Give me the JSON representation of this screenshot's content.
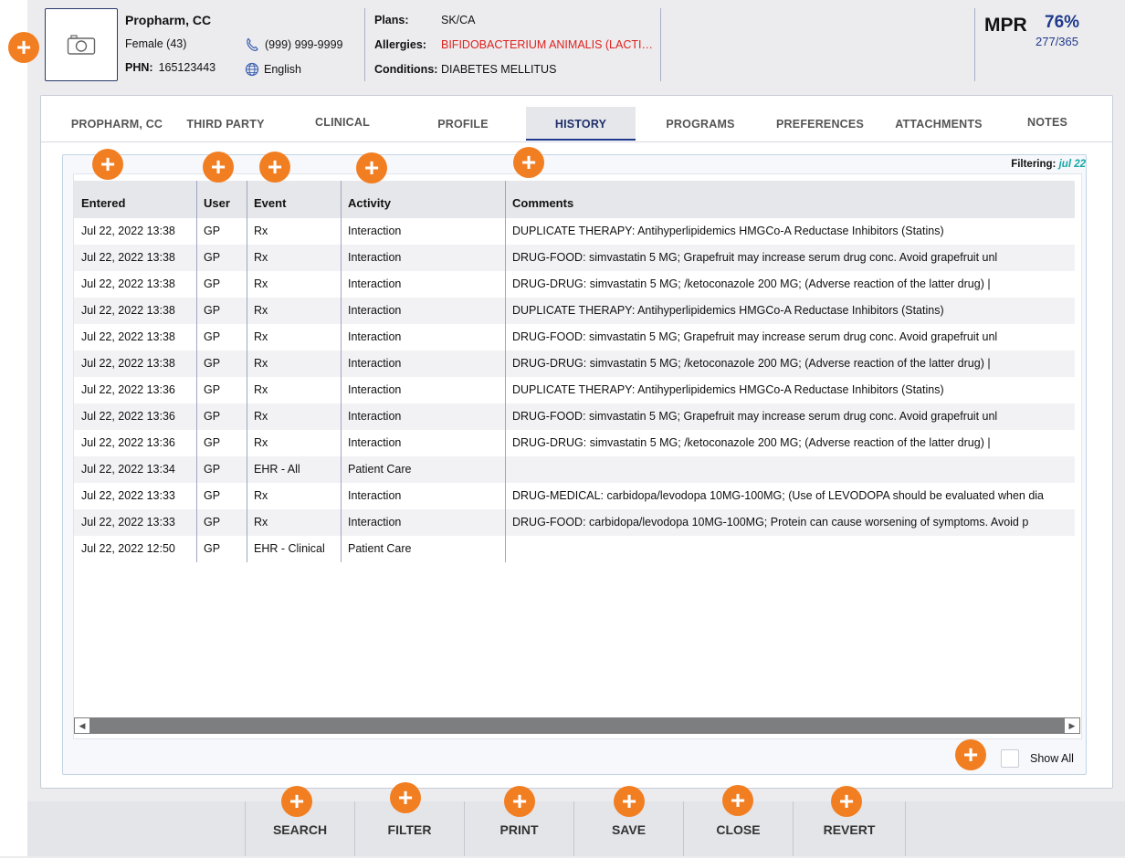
{
  "patient": {
    "name": "Propharm, CC",
    "sex_age": "Female (43)",
    "phn_label": "PHN:",
    "phn": "165123443",
    "phone": "(999) 999-9999",
    "language": "English"
  },
  "info": {
    "plans_label": "Plans:",
    "plans": "SK/CA",
    "allergies_label": "Allergies:",
    "allergies": "BIFIDOBACTERIUM ANIMALIS (LACTIS) BI...",
    "conditions_label": "Conditions:",
    "conditions": "DIABETES MELLITUS"
  },
  "mpr": {
    "label": "MPR",
    "percent": "76%",
    "ratio": "277/365"
  },
  "tabs": [
    {
      "label": "PROPHARM, CC",
      "active": false
    },
    {
      "label": "THIRD PARTY",
      "active": false
    },
    {
      "label": "CLINICAL",
      "active": false
    },
    {
      "label": "PROFILE",
      "active": false
    },
    {
      "label": "HISTORY",
      "active": true
    },
    {
      "label": "PROGRAMS",
      "active": false
    },
    {
      "label": "PREFERENCES",
      "active": false
    },
    {
      "label": "ATTACHMENTS",
      "active": false
    },
    {
      "label": "NOTES",
      "active": false
    }
  ],
  "filter": {
    "label": "Filtering:",
    "value": "jul 22"
  },
  "columns": [
    "Entered",
    "User",
    "Event",
    "Activity",
    "Comments"
  ],
  "rows": [
    [
      "Jul 22, 2022 13:38",
      "GP",
      "Rx",
      "Interaction",
      "DUPLICATE THERAPY: Antihyperlipidemics HMGCo-A Reductase Inhibitors (Statins)"
    ],
    [
      "Jul 22, 2022 13:38",
      "GP",
      "Rx",
      "Interaction",
      "DRUG-FOOD: simvastatin 5 MG; Grapefruit may increase serum drug conc. Avoid grapefruit unl"
    ],
    [
      "Jul 22, 2022 13:38",
      "GP",
      "Rx",
      "Interaction",
      "DRUG-DRUG: simvastatin 5 MG; /ketoconazole 200 MG; (Adverse reaction of the latter drug) |"
    ],
    [
      "Jul 22, 2022 13:38",
      "GP",
      "Rx",
      "Interaction",
      "DUPLICATE THERAPY: Antihyperlipidemics HMGCo-A Reductase Inhibitors (Statins)"
    ],
    [
      "Jul 22, 2022 13:38",
      "GP",
      "Rx",
      "Interaction",
      "DRUG-FOOD: simvastatin 5 MG; Grapefruit may increase serum drug conc. Avoid grapefruit unl"
    ],
    [
      "Jul 22, 2022 13:38",
      "GP",
      "Rx",
      "Interaction",
      "DRUG-DRUG: simvastatin 5 MG; /ketoconazole 200 MG; (Adverse reaction of the latter drug) |"
    ],
    [
      "Jul 22, 2022 13:36",
      "GP",
      "Rx",
      "Interaction",
      "DUPLICATE THERAPY: Antihyperlipidemics HMGCo-A Reductase Inhibitors (Statins)"
    ],
    [
      "Jul 22, 2022 13:36",
      "GP",
      "Rx",
      "Interaction",
      "DRUG-FOOD: simvastatin 5 MG; Grapefruit may increase serum drug conc. Avoid grapefruit unl"
    ],
    [
      "Jul 22, 2022 13:36",
      "GP",
      "Rx",
      "Interaction",
      "DRUG-DRUG: simvastatin 5 MG; /ketoconazole 200 MG; (Adverse reaction of the latter drug) |"
    ],
    [
      "Jul 22, 2022 13:34",
      "GP",
      "EHR - All",
      "Patient Care",
      ""
    ],
    [
      "Jul 22, 2022 13:33",
      "GP",
      "Rx",
      "Interaction",
      "DRUG-MEDICAL: carbidopa/levodopa 10MG-100MG; (Use of LEVODOPA should be evaluated when dia"
    ],
    [
      "Jul 22, 2022 13:33",
      "GP",
      "Rx",
      "Interaction",
      "DRUG-FOOD: carbidopa/levodopa 10MG-100MG; Protein can cause worsening of symptoms. Avoid p"
    ],
    [
      "Jul 22, 2022 12:50",
      "GP",
      "EHR - Clinical",
      "Patient Care",
      ""
    ]
  ],
  "show_all": "Show All",
  "buttons": [
    "SEARCH",
    "FILTER",
    "PRINT",
    "SAVE",
    "CLOSE",
    "REVERT"
  ],
  "icons": {
    "photo": "camera-icon",
    "phone": "phone-icon",
    "language": "globe-icon",
    "marker": "plus-icon",
    "scroll_left": "scroll-left-arrow",
    "scroll_right": "scroll-right-arrow"
  },
  "colors": {
    "accent": "#1f3a8c",
    "marker": "#f27e22",
    "allergy": "#e0201d",
    "filter_value": "#12a7a7"
  }
}
